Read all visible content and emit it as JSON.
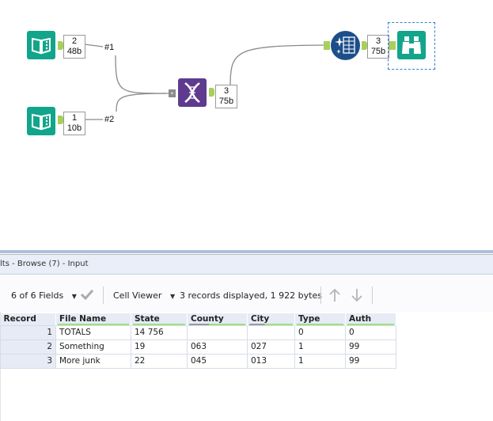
{
  "canvas": {
    "tools": [
      {
        "id": "input-1",
        "type": "input-data",
        "icon": "book-icon",
        "record_count": "2",
        "size": "48b"
      },
      {
        "id": "input-2",
        "type": "input-data",
        "icon": "book-icon",
        "record_count": "1",
        "size": "10b"
      },
      {
        "id": "union",
        "type": "union",
        "icon": "dna-icon",
        "record_count": "3",
        "size": "75b"
      },
      {
        "id": "summarize",
        "type": "data-cleansing",
        "icon": "sparkle-table-icon",
        "record_count": "3",
        "size": "75b"
      },
      {
        "id": "browse",
        "type": "browse",
        "icon": "binoculars-icon",
        "selected": true
      }
    ],
    "wire_labels": [
      "#1",
      "#2"
    ],
    "colors": {
      "input_tool": "#11a58b",
      "union_tool": "#5e3b8e",
      "anchor": "#a7d05b",
      "selection": "#2f7fd1"
    }
  },
  "results": {
    "title": "lts - Browse (7) - Input",
    "toolbar": {
      "fields_selector": "6 of 6 Fields",
      "cell_viewer": "Cell Viewer",
      "status": "3 records displayed, 1 922 bytes"
    },
    "columns": [
      "Record",
      "File Name",
      "State",
      "County",
      "City",
      "Type",
      "Auth"
    ],
    "rows": [
      [
        "1",
        "TOTALS",
        "14 756",
        "",
        "",
        "0",
        "0"
      ],
      [
        "2",
        "Something",
        "19",
        "063",
        "027",
        "1",
        "99"
      ],
      [
        "3",
        "More junk",
        "22",
        "045",
        "013",
        "1",
        "99"
      ]
    ]
  }
}
